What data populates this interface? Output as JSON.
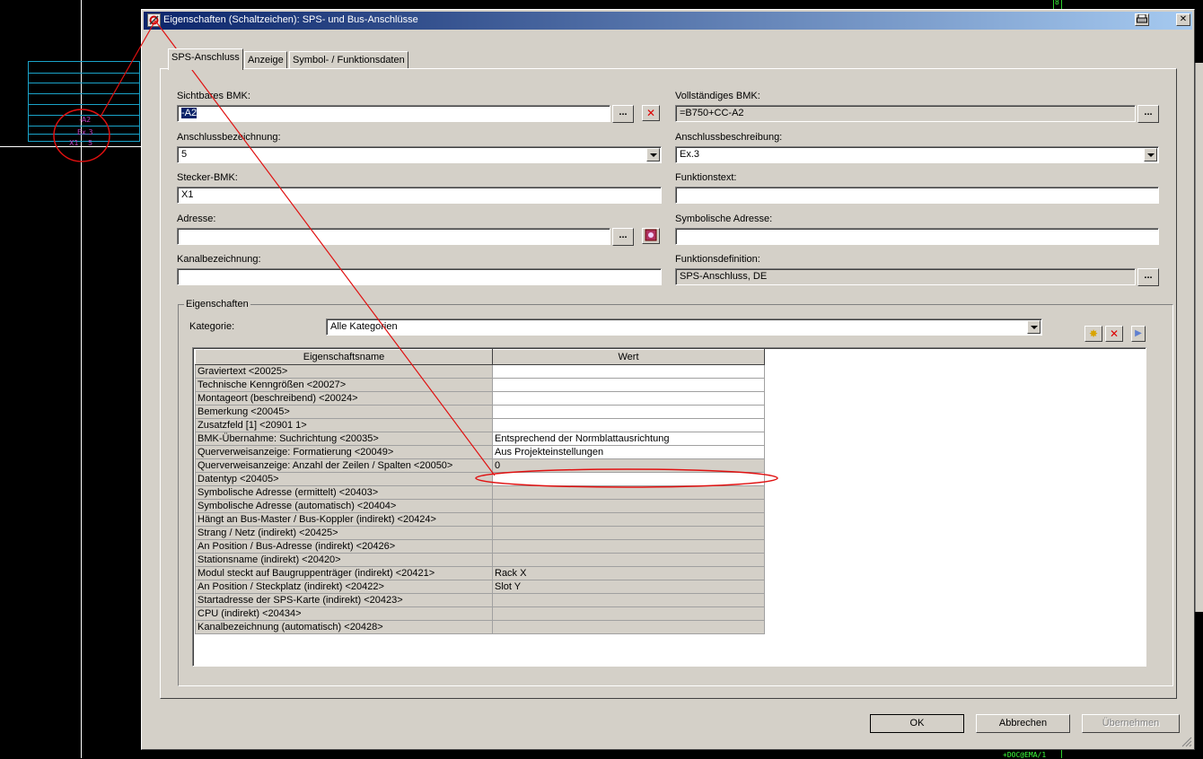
{
  "background": {
    "cad_labels": [
      "-A2",
      "Ex.3",
      "X1",
      "5"
    ],
    "bottom_text": "+DOC@EMA/1",
    "top_mark": "8"
  },
  "dialog": {
    "title": "Eigenschaften (Schaltzeichen): SPS- und Bus-Anschlüsse",
    "tabs": [
      "SPS-Anschluss",
      "Anzeige",
      "Symbol- / Funktionsdaten"
    ],
    "fields": {
      "sichtbares_bmk": {
        "label": "Sichtbares BMK:",
        "value": "-A2"
      },
      "vollstaendiges_bmk": {
        "label": "Vollständiges BMK:",
        "value": "=B750+CC-A2"
      },
      "anschlussbezeichnung": {
        "label": "Anschlussbezeichnung:",
        "value": "5"
      },
      "anschlussbeschreibung": {
        "label": "Anschlussbeschreibung:",
        "value": "Ex.3"
      },
      "stecker_bmk": {
        "label": "Stecker-BMK:",
        "value": "X1"
      },
      "funktionstext": {
        "label": "Funktionstext:",
        "value": ""
      },
      "adresse": {
        "label": "Adresse:",
        "value": ""
      },
      "symbolische_adresse": {
        "label": "Symbolische Adresse:",
        "value": ""
      },
      "kanalbezeichnung": {
        "label": "Kanalbezeichnung:",
        "value": ""
      },
      "funktionsdefinition": {
        "label": "Funktionsdefinition:",
        "value": "SPS-Anschluss, DE"
      }
    },
    "ellipsis": "...",
    "properties": {
      "group_label": "Eigenschaften",
      "kategorie_label": "Kategorie:",
      "kategorie_value": "Alle Kategorien",
      "columns": [
        "Eigenschaftsname",
        "Wert"
      ],
      "rows": [
        {
          "name": "Graviertext <20025>",
          "value": "",
          "editable": true
        },
        {
          "name": "Technische Kenngrößen <20027>",
          "value": "",
          "editable": true
        },
        {
          "name": "Montageort (beschreibend) <20024>",
          "value": "",
          "editable": true
        },
        {
          "name": "Bemerkung <20045>",
          "value": "",
          "editable": true
        },
        {
          "name": "Zusatzfeld [1] <20901 1>",
          "value": "",
          "editable": true
        },
        {
          "name": "BMK-Übernahme: Suchrichtung <20035>",
          "value": "Entsprechend der Normblattausrichtung",
          "editable": true
        },
        {
          "name": "Querverweisanzeige: Formatierung <20049>",
          "value": "Aus Projekteinstellungen",
          "editable": true
        },
        {
          "name": "Querverweisanzeige: Anzahl der Zeilen / Spalten <20050>",
          "value": "0",
          "editable": false
        },
        {
          "name": "Datentyp <20405>",
          "value": "",
          "editable": true
        },
        {
          "name": "Symbolische Adresse (ermittelt) <20403>",
          "value": "",
          "editable": false
        },
        {
          "name": "Symbolische Adresse (automatisch) <20404>",
          "value": "",
          "editable": false
        },
        {
          "name": "Hängt an Bus-Master / Bus-Koppler (indirekt) <20424>",
          "value": "",
          "editable": false
        },
        {
          "name": "Strang / Netz (indirekt) <20425>",
          "value": "",
          "editable": false
        },
        {
          "name": "An Position / Bus-Adresse (indirekt) <20426>",
          "value": "",
          "editable": false
        },
        {
          "name": "Stationsname (indirekt) <20420>",
          "value": "",
          "editable": false
        },
        {
          "name": "Modul steckt auf Baugruppenträger (indirekt) <20421>",
          "value": "Rack X",
          "editable": false
        },
        {
          "name": "An Position / Steckplatz (indirekt) <20422>",
          "value": "Slot Y",
          "editable": false
        },
        {
          "name": "Startadresse der SPS-Karte (indirekt) <20423>",
          "value": "",
          "editable": false
        },
        {
          "name": "CPU (indirekt) <20434>",
          "value": "",
          "editable": false
        },
        {
          "name": "Kanalbezeichnung (automatisch) <20428>",
          "value": "",
          "editable": false
        }
      ]
    },
    "buttons": {
      "ok": "OK",
      "cancel": "Abbrechen",
      "apply": "Übernehmen"
    }
  },
  "colors": {
    "annotation": "#e01010",
    "titlebar_start": "#0a246a",
    "titlebar_end": "#a6caf0"
  },
  "icons": [
    "title-app-icon",
    "print-icon",
    "close-icon",
    "clear-red-x-icon",
    "address-picker-icon",
    "new-property-icon",
    "delete-property-icon",
    "play-arrow-icon"
  ]
}
